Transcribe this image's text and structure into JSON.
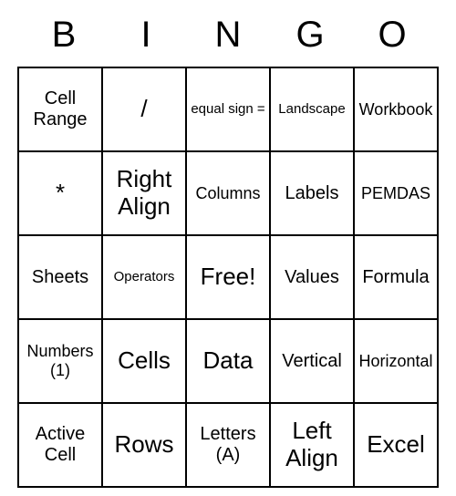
{
  "header": [
    "B",
    "I",
    "N",
    "G",
    "O"
  ],
  "grid": [
    [
      {
        "text": "Cell Range",
        "size": "normal"
      },
      {
        "text": "/",
        "size": "big"
      },
      {
        "text": "equal sign =",
        "size": "small"
      },
      {
        "text": "Landscape",
        "size": "small"
      },
      {
        "text": "Workbook",
        "size": "mid"
      }
    ],
    [
      {
        "text": "*",
        "size": "big"
      },
      {
        "text": "Right Align",
        "size": "big"
      },
      {
        "text": "Columns",
        "size": "mid"
      },
      {
        "text": "Labels",
        "size": "normal"
      },
      {
        "text": "PEMDAS",
        "size": "mid"
      }
    ],
    [
      {
        "text": "Sheets",
        "size": "normal"
      },
      {
        "text": "Operators",
        "size": "small"
      },
      {
        "text": "Free!",
        "size": "big"
      },
      {
        "text": "Values",
        "size": "normal"
      },
      {
        "text": "Formula",
        "size": "normal"
      }
    ],
    [
      {
        "text": "Numbers (1)",
        "size": "mid"
      },
      {
        "text": "Cells",
        "size": "big"
      },
      {
        "text": "Data",
        "size": "big"
      },
      {
        "text": "Vertical",
        "size": "normal"
      },
      {
        "text": "Horizontal",
        "size": "mid"
      }
    ],
    [
      {
        "text": "Active Cell",
        "size": "normal"
      },
      {
        "text": "Rows",
        "size": "big"
      },
      {
        "text": "Letters (A)",
        "size": "normal"
      },
      {
        "text": "Left Align",
        "size": "big"
      },
      {
        "text": "Excel",
        "size": "big"
      }
    ]
  ]
}
